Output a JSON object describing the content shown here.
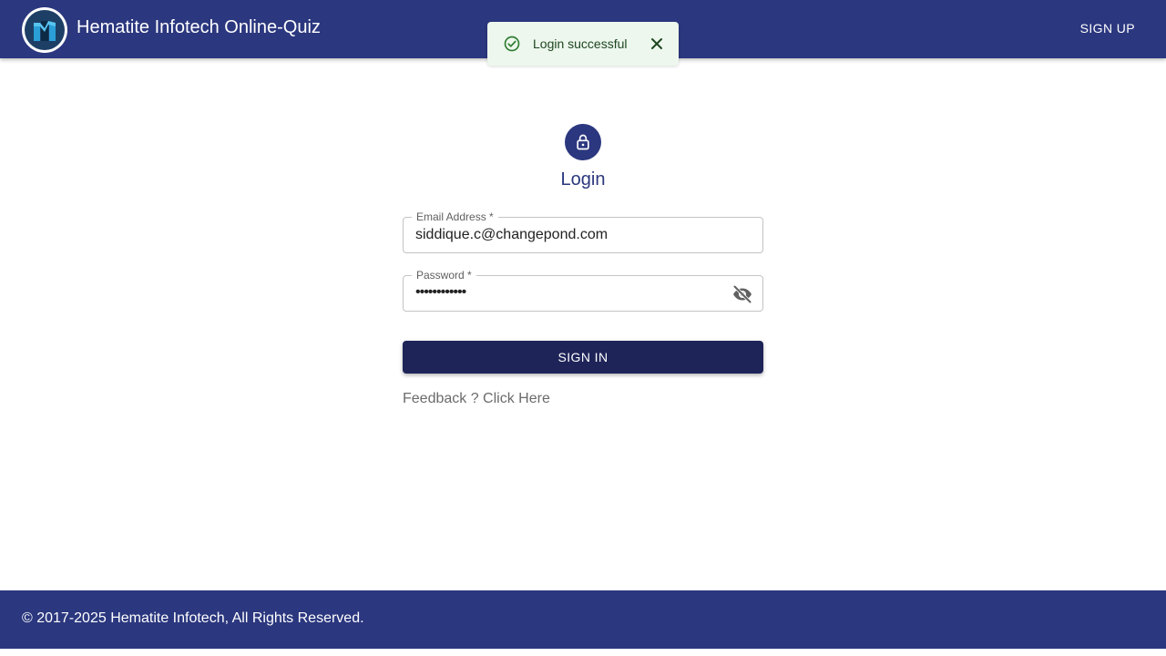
{
  "header": {
    "app_title": "Hematite Infotech Online-Quiz",
    "signup_label": "SIGN UP",
    "logo_icon": "books-logo-icon"
  },
  "toast": {
    "message": "Login successful",
    "status_icon": "check-circle-icon",
    "close_icon": "close-icon",
    "accent_color": "#2e7d32"
  },
  "login": {
    "lock_icon": "lock-icon",
    "title": "Login",
    "email": {
      "label": "Email Address *",
      "value": "siddique.c@changepond.com"
    },
    "password": {
      "label": "Password *",
      "value": "••••••••••••",
      "toggle_icon": "eye-off-icon"
    },
    "signin_label": "SIGN IN",
    "feedback_text": "Feedback ? Click Here"
  },
  "footer": {
    "copyright": "© 2017-2025 Hematite Infotech, All Rights Reserved."
  },
  "colors": {
    "brand": "#2b377e",
    "button": "#1e2458",
    "toast_bg": "#edf7ed"
  }
}
